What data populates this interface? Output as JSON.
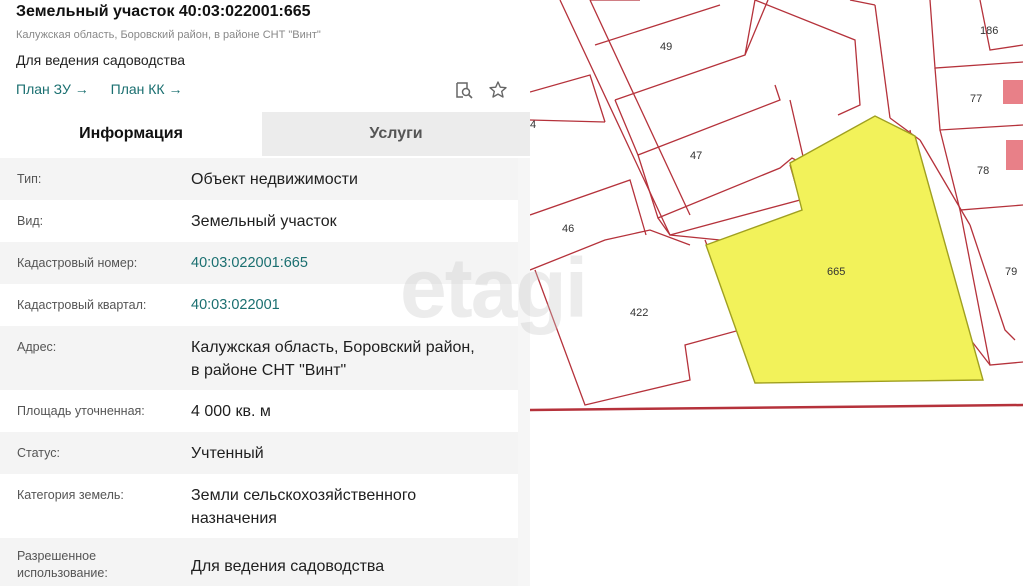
{
  "header": {
    "title": "Земельный участок 40:03:022001:665",
    "subtitle": "Калужская область, Боровский район, в районе СНТ \"Винт\"",
    "purpose": "Для ведения садоводства",
    "link_plan_zu": "План ЗУ",
    "link_plan_kk": "План КК",
    "arrow": "→"
  },
  "tabs": {
    "info": "Информация",
    "services": "Услуги"
  },
  "rows": [
    {
      "label": "Тип:",
      "value": "Объект недвижимости"
    },
    {
      "label": "Вид:",
      "value": "Земельный участок"
    },
    {
      "label": "Кадастровый номер:",
      "value": "40:03:022001:665"
    },
    {
      "label": "Кадастровый квартал:",
      "value": "40:03:022001"
    },
    {
      "label": "Адрес:",
      "value_line1": "Калужская область, Боровский район,",
      "value_line2": "в районе СНТ \"Винт\""
    },
    {
      "label": "Площадь уточненная:",
      "value": "4 000 кв. м"
    },
    {
      "label": "Статус:",
      "value": "Учтенный"
    },
    {
      "label": "Категория земель:",
      "value_line1": "Земли сельскохозяйственного",
      "value_line2": "назначения"
    },
    {
      "label_line1": "Разрешенное",
      "label_line2": "использование:",
      "value": "Для ведения садоводства"
    }
  ],
  "map": {
    "watermark": "etagi",
    "parcels": {
      "p186": "186",
      "p49": "49",
      "p77": "77",
      "p47": "47",
      "p78": "78",
      "p46": "46",
      "p665": "665",
      "p79": "79",
      "p422": "422",
      "p4": "4"
    },
    "colors": {
      "boundary": "#b5323b",
      "selected_fill": "#f2f25a",
      "selected_stroke": "#a0a020",
      "building": "#e88088"
    }
  },
  "icons": {
    "plan_search": "map-search-icon",
    "favorite": "star-icon"
  }
}
